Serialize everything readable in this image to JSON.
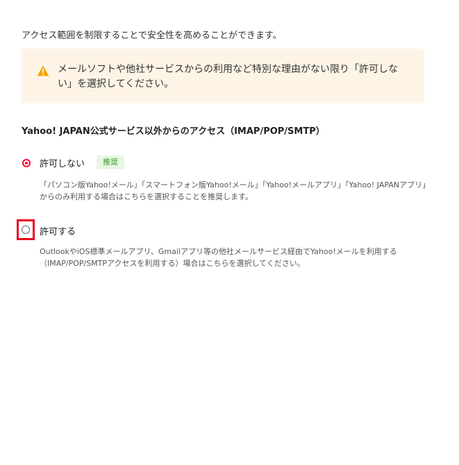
{
  "intro_text": "アクセス範囲を制限することで安全性を高めることができます。",
  "warning": {
    "icon": "warning-icon",
    "text": "メールソフトや他社サービスからの利用など特別な理由がない限り「許可しない」を選択してください。"
  },
  "section": {
    "title": "Yahoo! JAPAN公式サービス以外からのアクセス（IMAP/POP/SMTP）"
  },
  "options": [
    {
      "label": "許可しない",
      "badge": "推奨",
      "selected": true,
      "description": "「パソコン版Yahoo!メール」「スマートフォン版Yahoo!メール」「Yahoo!メールアプリ」「Yahoo! JAPANアプリ」からのみ利用する場合はこちらを選択することを推奨します。"
    },
    {
      "label": "許可する",
      "selected": false,
      "description": "OutlookやiOS標準メールアプリ、Gmailアプリ等の他社メールサービス経由でYahoo!メールを利用する（IMAP/POP/SMTPアクセスを利用する）場合はこちらを選択してください。"
    }
  ],
  "colors": {
    "warning_bg": "#fef4e6",
    "warning_icon": "#f5a300",
    "radio_selected": "#ff0033",
    "badge_bg": "#e8f7e4",
    "badge_text": "#3f9a2c",
    "highlight": "#e8001c"
  }
}
